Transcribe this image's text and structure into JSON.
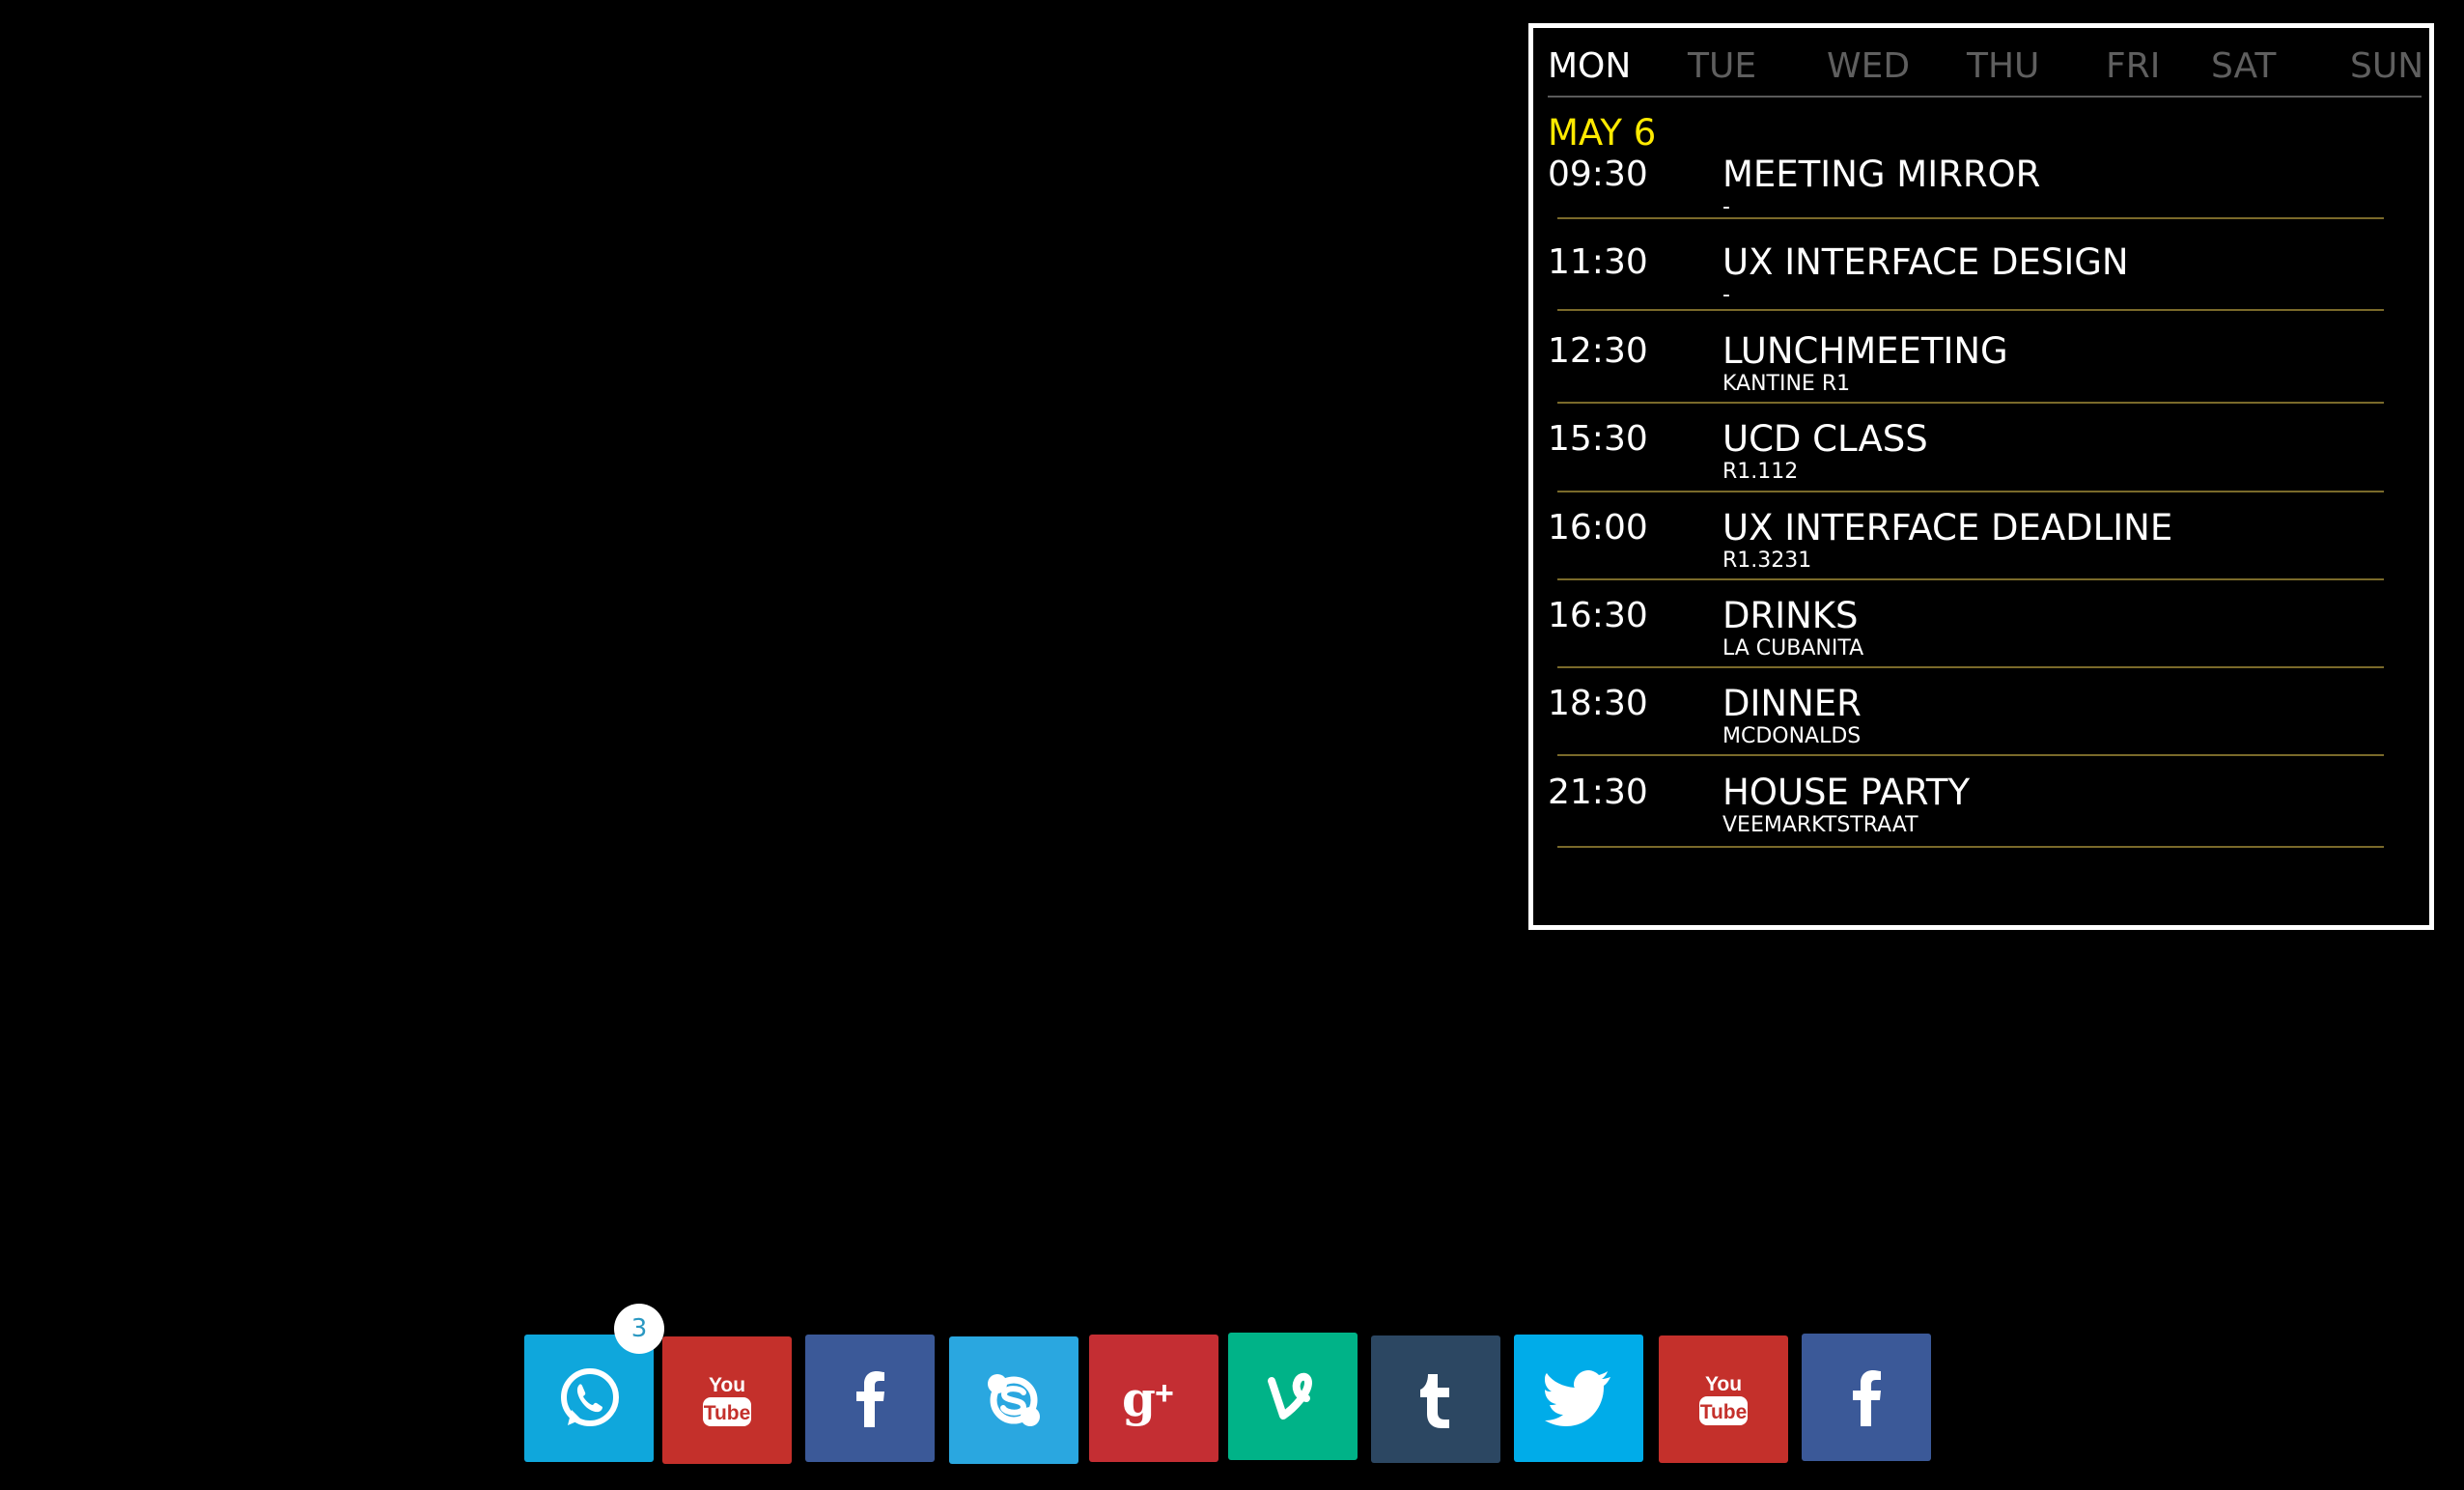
{
  "calendar": {
    "days": [
      "MON",
      "TUE",
      "WED",
      "THU",
      "FRI",
      "SAT",
      "SUN"
    ],
    "active_day": "MON",
    "date": "MAY 6",
    "events": [
      {
        "time": "09:30",
        "title": "MEETING MIRROR",
        "location": "-"
      },
      {
        "time": "11:30",
        "title": "UX INTERFACE DESIGN",
        "location": "-"
      },
      {
        "time": "12:30",
        "title": "LUNCHMEETING",
        "location": "KANTINE R1"
      },
      {
        "time": "15:30",
        "title": "UCD CLASS",
        "location": "R1.112"
      },
      {
        "time": "16:00",
        "title": "UX INTERFACE DEADLINE",
        "location": "R1.3231"
      },
      {
        "time": "16:30",
        "title": "DRINKS",
        "location": "LA CUBANITA"
      },
      {
        "time": "18:30",
        "title": "DINNER",
        "location": "MCDONALDS"
      },
      {
        "time": "21:30",
        "title": "HOUSE PARTY",
        "location": "VEEMARKTSTRAAT"
      }
    ],
    "colors": {
      "border": "#ffffff",
      "active_day": "#ffffff",
      "inactive_day": "#5f5f5f",
      "date": "#ffea00",
      "divider": "#7a6a2a"
    }
  },
  "dock": {
    "apps": [
      {
        "name": "whatsapp",
        "icon": "whatsapp-icon",
        "color": "#0fa7dc"
      },
      {
        "name": "youtube",
        "icon": "youtube-icon",
        "color": "#c4302b"
      },
      {
        "name": "facebook",
        "icon": "facebook-icon",
        "color": "#3b5998"
      },
      {
        "name": "skype",
        "icon": "skype-icon",
        "color": "#2aa7e0"
      },
      {
        "name": "google-plus",
        "icon": "google-plus-icon",
        "color": "#c42e33"
      },
      {
        "name": "vine",
        "icon": "vine-icon",
        "color": "#00b388"
      },
      {
        "name": "tumblr",
        "icon": "tumblr-icon",
        "color": "#2c4762"
      },
      {
        "name": "twitter",
        "icon": "twitter-icon",
        "color": "#00ace9"
      },
      {
        "name": "youtube",
        "icon": "youtube-icon",
        "color": "#c4302b"
      },
      {
        "name": "facebook",
        "icon": "facebook-icon",
        "color": "#3b5998"
      }
    ],
    "whatsapp_badge": "3"
  }
}
